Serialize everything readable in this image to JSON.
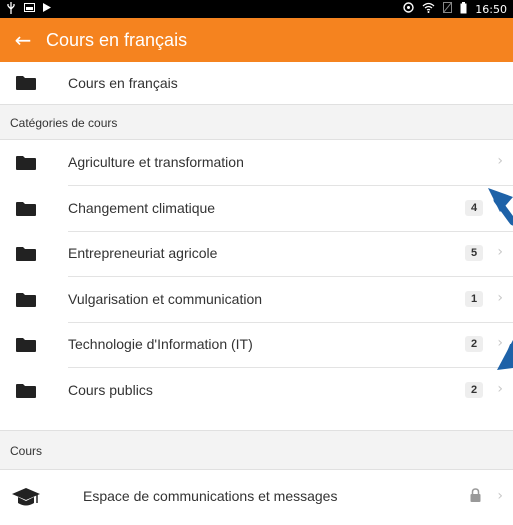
{
  "status_bar": {
    "left_icons": [
      "usb-icon",
      "image-icon",
      "play-icon"
    ],
    "right_icons": [
      "data-icon",
      "wifi-icon",
      "no-sim-icon",
      "battery-icon"
    ],
    "time": "16:50"
  },
  "app_bar": {
    "back_icon": "arrow-left-icon",
    "title": "Cours en français",
    "background_color": "#f5831f"
  },
  "top_item": {
    "label": "Cours en français",
    "icon": "folder-icon"
  },
  "sections": {
    "categories_title": "Catégories de cours",
    "courses_title": "Cours"
  },
  "categories": [
    {
      "label": "Agriculture et transformation",
      "count": null
    },
    {
      "label": "Changement climatique",
      "count": "4"
    },
    {
      "label": "Entrepreneuriat agricole",
      "count": "5"
    },
    {
      "label": "Vulgarisation et communication",
      "count": "1"
    },
    {
      "label": "Technologie d'Information (IT)",
      "count": "2"
    },
    {
      "label": "Cours publics",
      "count": "2"
    }
  ],
  "courses": [
    {
      "label": "Espace de communications et messages",
      "icon": "graduation-cap-icon",
      "status_icon": "lock-icon"
    }
  ],
  "annotation_color": "#1e62a8"
}
